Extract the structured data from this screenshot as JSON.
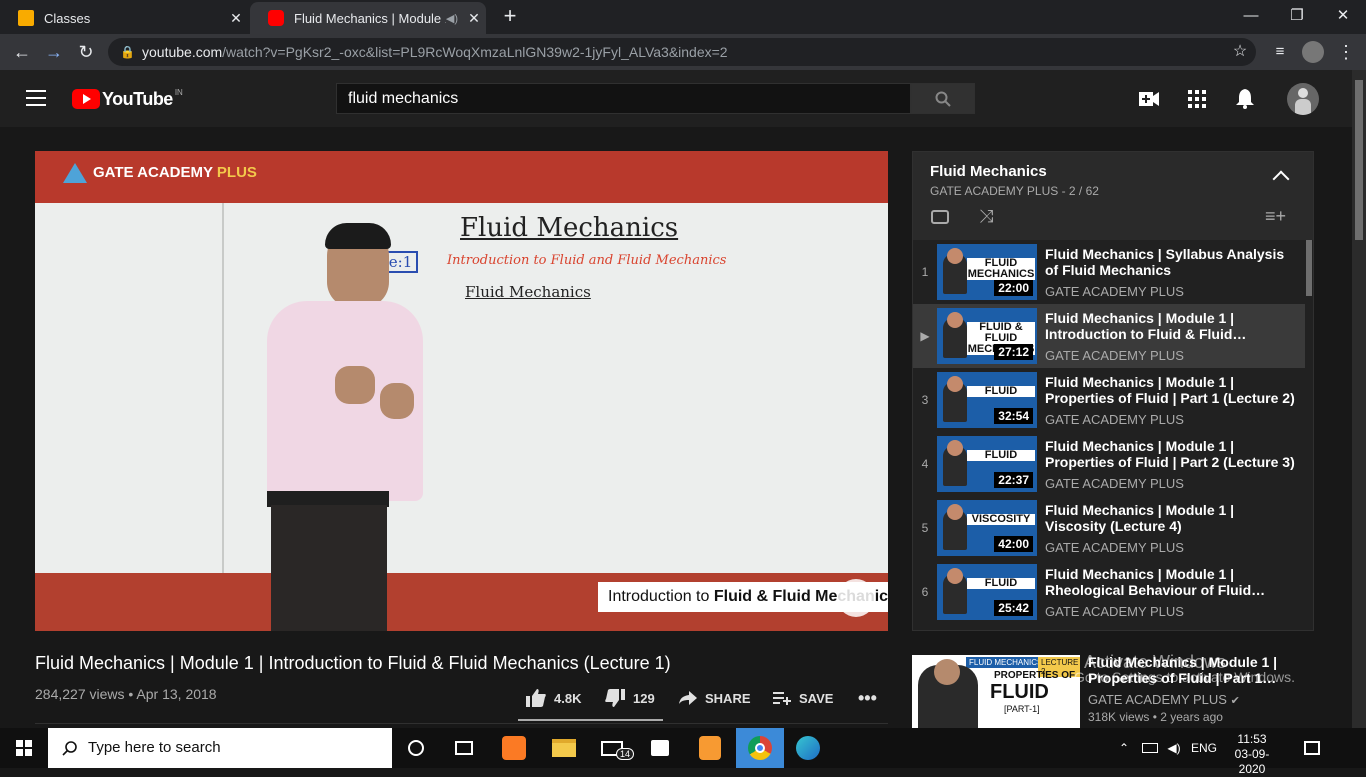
{
  "browser": {
    "tabs": [
      {
        "title": "Classes",
        "favicon_color": "#f9ab00"
      },
      {
        "title": "Fluid Mechanics | Module 1 |",
        "favicon_color": "#ff0000"
      }
    ],
    "url_domain": "youtube.com",
    "url_rest": "/watch?v=PgKsr2_-oxc&list=PL9RcWoqXmzaLnlGN39w2-1jyFyl_ALVa3&index=2"
  },
  "youtube": {
    "logo_text": "YouTube",
    "logo_country": "IN",
    "search_value": "fluid mechanics"
  },
  "video": {
    "brand_main": "GATE ACADEMY",
    "brand_plus": "PLUS",
    "board_heading": "Fluid Mechanics",
    "board_subheading": "Introduction to Fluid and Fluid Mechanics",
    "board_line3": "Fluid Mechanics",
    "board_tag": "le:1",
    "lower_third_a": "Introduction to ",
    "lower_third_b": "Fluid & Fluid Mechanics",
    "title": "Fluid Mechanics | Module 1 | Introduction to Fluid & Fluid Mechanics (Lecture 1)",
    "meta": "284,227 views • Apr 13, 2018",
    "likes": "4.8K",
    "dislikes": "129",
    "share_label": "SHARE",
    "save_label": "SAVE"
  },
  "playlist": {
    "title": "Fluid Mechanics",
    "subtitle": "GATE ACADEMY PLUS - 2 / 62",
    "items": [
      {
        "index": "1",
        "title": "Fluid Mechanics | Syllabus Analysis of Fluid Mechanics",
        "channel": "GATE ACADEMY PLUS",
        "duration": "22:00",
        "thumb_text": "FLUID MECHANICS"
      },
      {
        "index": "▶",
        "title": "Fluid Mechanics | Module 1 | Introduction to Fluid & Fluid…",
        "channel": "GATE ACADEMY PLUS",
        "duration": "27:12",
        "thumb_text": "FLUID & FLUID MECHANICS"
      },
      {
        "index": "3",
        "title": "Fluid Mechanics | Module 1 | Properties of Fluid | Part 1 (Lecture 2)",
        "channel": "GATE ACADEMY PLUS",
        "duration": "32:54",
        "thumb_text": "FLUID"
      },
      {
        "index": "4",
        "title": "Fluid Mechanics | Module 1 | Properties of Fluid | Part 2 (Lecture 3)",
        "channel": "GATE ACADEMY PLUS",
        "duration": "22:37",
        "thumb_text": "FLUID"
      },
      {
        "index": "5",
        "title": "Fluid Mechanics | Module 1 | Viscosity (Lecture 4)",
        "channel": "GATE ACADEMY PLUS",
        "duration": "42:00",
        "thumb_text": "VISCOSITY"
      },
      {
        "index": "6",
        "title": "Fluid Mechanics | Module 1 | Rheological Behaviour of Fluid…",
        "channel": "GATE ACADEMY PLUS",
        "duration": "25:42",
        "thumb_text": "FLUID"
      }
    ]
  },
  "upnext": {
    "thumb_label": "FLUID MECHANICS",
    "thumb_lecture": "LECTURE 2",
    "thumb_head": "PROPERTIES OF",
    "thumb_big": "FLUID",
    "thumb_part": "[PART-1]",
    "title": "Fluid Mechanics | Module 1 | Properties of Fluid | Part 1…",
    "channel": "GATE ACADEMY PLUS",
    "meta": "318K views • 2 years ago"
  },
  "watermark": {
    "line1": "Activate Windows",
    "line2": "Go to Settings to activate Windows."
  },
  "taskbar": {
    "search_placeholder": "Type here to search",
    "mail_badge": "14",
    "lang": "ENG",
    "time": "11:53",
    "date": "03-09-2020"
  },
  "colors": {
    "youtube_red": "#ff0000",
    "accent": "#3ea6ff"
  }
}
